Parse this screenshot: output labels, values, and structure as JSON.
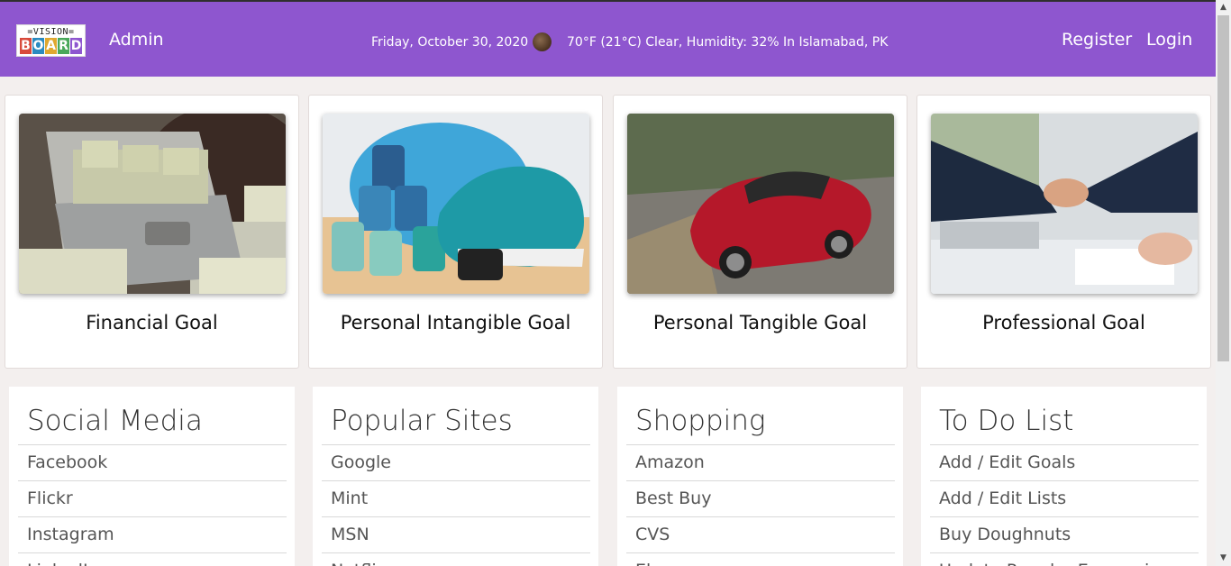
{
  "navbar": {
    "logo": {
      "top_text": "=VISION=",
      "letters": [
        "B",
        "O",
        "A",
        "R",
        "D"
      ],
      "letter_colors": [
        "#d84a3b",
        "#2b8ac0",
        "#e0a830",
        "#49a85a",
        "#8e56cf"
      ]
    },
    "brand": "Admin",
    "date": "Friday, October 30, 2020",
    "weather_icon": "moon-icon",
    "weather": "70°F (21°C) Clear, Humidity: 32% In Islamabad, PK",
    "register": "Register",
    "login": "Login",
    "color": "#8e56cf"
  },
  "goals": [
    {
      "title": "Financial Goal"
    },
    {
      "title": "Personal Intangible Goal"
    },
    {
      "title": "Personal Tangible Goal"
    },
    {
      "title": "Professional Goal"
    }
  ],
  "lists": [
    {
      "title": "Social Media",
      "items": [
        "Facebook",
        "Flickr",
        "Instagram",
        "LinkedIn"
      ]
    },
    {
      "title": "Popular Sites",
      "items": [
        "Google",
        "Mint",
        "MSN",
        "Netflix"
      ]
    },
    {
      "title": "Shopping",
      "items": [
        "Amazon",
        "Best Buy",
        "CVS",
        "Ebay"
      ]
    },
    {
      "title": "To Do List",
      "items": [
        "Add / Edit Goals",
        "Add / Edit Lists",
        "Buy Doughnuts",
        "Update Regular Expression"
      ]
    }
  ]
}
